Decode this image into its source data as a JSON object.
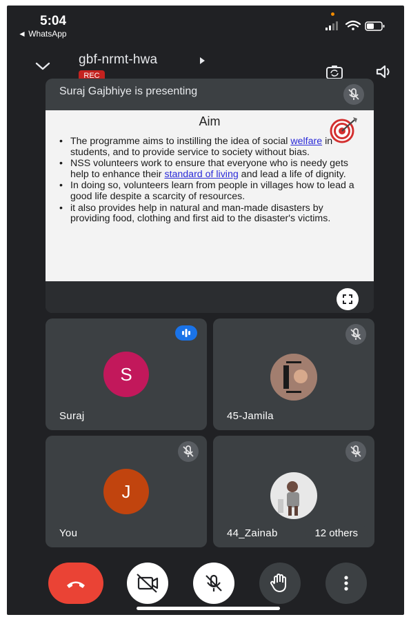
{
  "status_bar": {
    "time": "5:04",
    "back_label": "◄ WhatsApp"
  },
  "meeting": {
    "code": "gbf-nrmt-hwa",
    "rec_label": "REC"
  },
  "presentation": {
    "presenter_label": "Suraj Gajbhiye is presenting",
    "slide": {
      "title": "Aim",
      "bullets": [
        {
          "before": "The programme aims to instilling the idea of social ",
          "link": "welfare",
          "after": " in students, and to provide service to society without bias."
        },
        {
          "before": "NSS volunteers work to ensure that everyone who is needy gets help to enhance their ",
          "link": "standard of living",
          "after": " and lead a life of dignity."
        },
        {
          "before": "In doing so, volunteers learn from people in villages how to lead a good life despite a scarcity of resources.",
          "link": "",
          "after": ""
        },
        {
          "before": "it also provides help in natural and man-made disasters by providing food, clothing and first aid to the disaster's victims.",
          "link": "",
          "after": ""
        }
      ]
    }
  },
  "participants": [
    {
      "name": "Suraj",
      "initial": "S",
      "avatar_color": "#c2185b",
      "speaking": true
    },
    {
      "name": "45-Jamila",
      "initial": "",
      "muted": true
    },
    {
      "name": "You",
      "initial": "J",
      "avatar_color": "#c1440e",
      "muted": true
    },
    {
      "name": "44_Zainab",
      "initial": "",
      "muted": true
    }
  ],
  "others_label": "12 others",
  "controls": {
    "end_call_color": "#ea4335",
    "icons": [
      "end-call-icon",
      "camera-off-icon",
      "mic-off-icon",
      "raise-hand-icon",
      "more-options-icon"
    ]
  }
}
